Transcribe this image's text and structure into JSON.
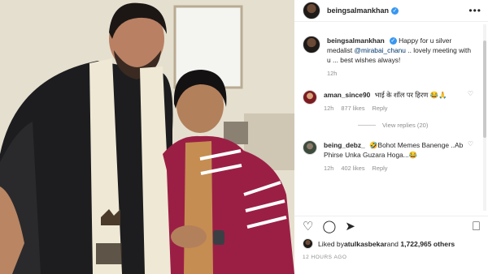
{
  "post": {
    "author": "beingsalmankhan",
    "more_icon": "•••",
    "caption_author": "beingsalmankhan",
    "caption_text": "Happy for u silver medalist ",
    "caption_mention": "@mirabai_chanu",
    "caption_tail": " .. lovely meeting with u ... best wishes always!",
    "caption_time": "12h"
  },
  "comments": [
    {
      "user": "aman_since90",
      "text": "भाई के शॉल पर हिरण 😂🙏",
      "time": "12h",
      "likes": "877 likes",
      "reply": "Reply",
      "view_replies": "View replies (20)"
    },
    {
      "user": "being_debz_",
      "text": "🤣Bohot Memes Banenge ..Ab Phirse Unka Guzara Hoga...😂",
      "time": "12h",
      "likes": "402 likes",
      "reply": "Reply"
    }
  ],
  "actions": {
    "like_icon": "♡",
    "comment_icon": "◯",
    "share_icon": "➤",
    "save_icon": "⎕"
  },
  "liked_by": {
    "prefix": "Liked by ",
    "user": "atulkasbekar",
    "middle": " and ",
    "count": "1,722,965 others"
  },
  "time_ago": "12 HOURS AGO",
  "colors": {
    "verified": "#3897f0",
    "link": "#00376b",
    "scarf": "#efe8d5",
    "jacket": "#9b1f45"
  }
}
